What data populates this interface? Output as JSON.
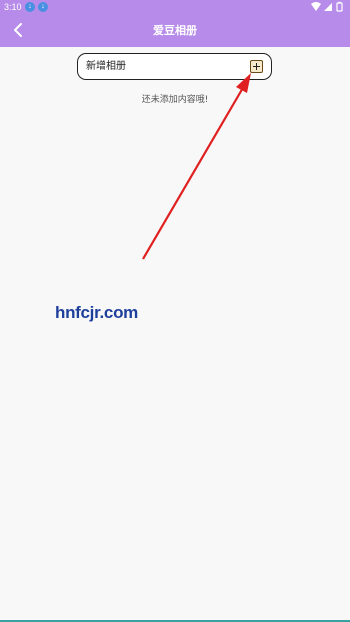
{
  "status_bar": {
    "time": "3:10",
    "notification_icons": [
      "notification-icon",
      "notification-icon"
    ],
    "system_icons": [
      "wifi-icon",
      "signal-icon",
      "battery-icon"
    ]
  },
  "header": {
    "title": "爱豆相册",
    "back_icon": "chevron-left-icon"
  },
  "album": {
    "new_album_label": "新增相册",
    "add_icon": "plus-square-icon"
  },
  "empty_state": {
    "message": "还未添加内容哦!"
  },
  "watermark": {
    "text": "hnfcjr.com"
  },
  "colors": {
    "header_bg": "#b68be9",
    "page_bg": "#f8f8f8",
    "annotation_arrow": "#e02020",
    "watermark": "#1e3f9c",
    "add_button_bg": "#f7eacb"
  }
}
